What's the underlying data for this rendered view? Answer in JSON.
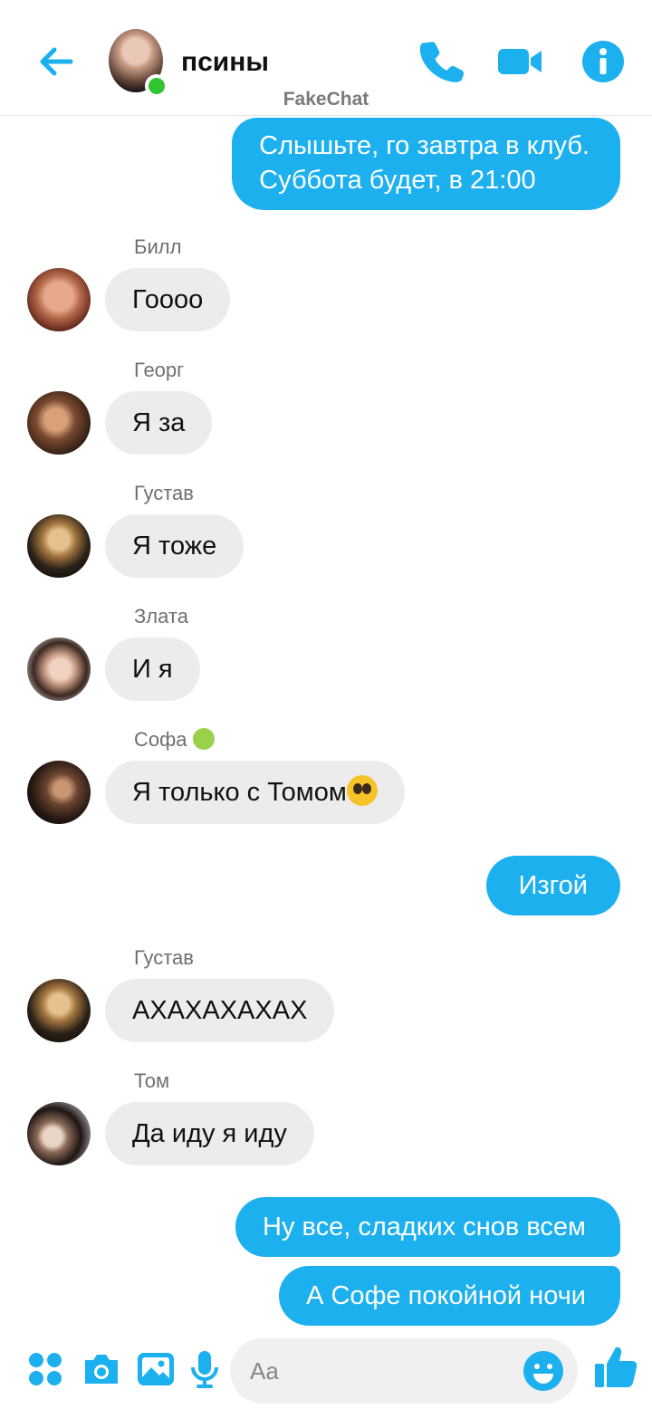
{
  "header": {
    "title": "псины",
    "watermark": "FakeChat"
  },
  "colors": {
    "accent": "#1cb0ef",
    "online": "#31c42c",
    "incoming_bubble": "#ececec"
  },
  "messages": [
    {
      "type": "out",
      "text_lines": [
        "Слышьте, го завтра в клуб.",
        "Суббота будет, в 21:00"
      ]
    },
    {
      "type": "in",
      "sender": "Билл",
      "text": "Гоооо"
    },
    {
      "type": "in",
      "sender": "Георг",
      "text": "Я за"
    },
    {
      "type": "in",
      "sender": "Густав",
      "text": "Я тоже"
    },
    {
      "type": "in",
      "sender": "Злата",
      "text": "И я"
    },
    {
      "type": "in",
      "sender": "Софа",
      "sender_emoji": "nauseated-face",
      "text": "Я только с Томом",
      "text_emoji": "pleading-face"
    },
    {
      "type": "out",
      "text": "Изгой"
    },
    {
      "type": "in",
      "sender": "Густав",
      "text": "АХАХАХАХАХ"
    },
    {
      "type": "in",
      "sender": "Том",
      "text": "Да иду я иду"
    },
    {
      "type": "out",
      "text": "Ну все, сладких снов всем"
    },
    {
      "type": "out",
      "text": "А Софе покойной ночи"
    }
  ],
  "composer": {
    "placeholder": "Aa",
    "icons": [
      "menu-dots-icon",
      "camera-icon",
      "gallery-icon",
      "microphone-icon",
      "emoji-icon",
      "like-icon"
    ]
  }
}
